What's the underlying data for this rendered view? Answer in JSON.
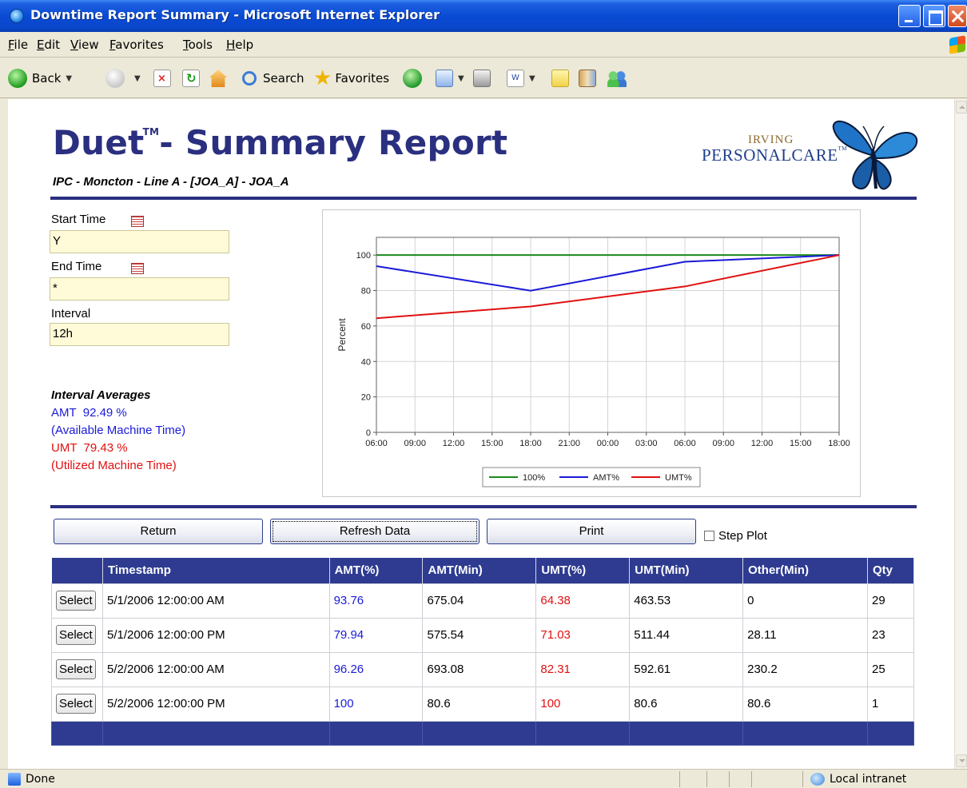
{
  "window": {
    "title": "Downtime Report Summary - Microsoft Internet Explorer"
  },
  "menu": [
    "File",
    "Edit",
    "View",
    "Favorites",
    "Tools",
    "Help"
  ],
  "toolbar": {
    "back": "Back",
    "search": "Search",
    "favorites": "Favorites"
  },
  "header": {
    "title": "Duet",
    "tm": "TM",
    "title_rest": "- Summary Report",
    "subtitle": "IPC - Moncton - Line A - [JOA_A] - JOA_A",
    "logo_top": "IRVING",
    "logo_bottom": "PERSONALCARE",
    "logo_tm": "TM"
  },
  "form": {
    "start_label": "Start Time",
    "start_value": "Y",
    "end_label": "End Time",
    "end_value": "*",
    "interval_label": "Interval",
    "interval_value": "12h"
  },
  "averages": {
    "heading": "Interval Averages",
    "amt": "AMT  92.49 %",
    "amt_desc": "(Available Machine Time)",
    "umt": "UMT  79.43 %",
    "umt_desc": "(Utilized Machine Time)"
  },
  "chart_data": {
    "type": "line",
    "ylabel": "Percent",
    "ylim": [
      0,
      110
    ],
    "yticks": [
      0,
      20,
      40,
      60,
      80,
      100
    ],
    "xticks": [
      "06:00",
      "09:00",
      "12:00",
      "15:00",
      "18:00",
      "21:00",
      "00:00",
      "03:00",
      "06:00",
      "09:00",
      "12:00",
      "15:00",
      "18:00"
    ],
    "grid": true,
    "legend_position": "bottom",
    "series": [
      {
        "name": "100%",
        "color": "#1a8a1a",
        "points": [
          [
            0,
            100
          ],
          [
            12,
            100
          ]
        ]
      },
      {
        "name": "AMT%",
        "color": "#1a1ad8",
        "points": [
          [
            0,
            93.76
          ],
          [
            4,
            79.94
          ],
          [
            8,
            96.26
          ],
          [
            12,
            100
          ]
        ]
      },
      {
        "name": "UMT%",
        "color": "#e01010",
        "points": [
          [
            0,
            64.38
          ],
          [
            4,
            71.03
          ],
          [
            8,
            82.31
          ],
          [
            12,
            100
          ]
        ]
      }
    ]
  },
  "buttons": {
    "return": "Return",
    "refresh": "Refresh Data",
    "print": "Print",
    "step_plot": "Step Plot"
  },
  "table": {
    "headers": [
      "",
      "Timestamp",
      "AMT(%)",
      "AMT(Min)",
      "UMT(%)",
      "UMT(Min)",
      "Other(Min)",
      "Qty"
    ],
    "select_label": "Select",
    "rows": [
      [
        "5/1/2006 12:00:00 AM",
        "93.76",
        "675.04",
        "64.38",
        "463.53",
        "0",
        "29"
      ],
      [
        "5/1/2006 12:00:00 PM",
        "79.94",
        "575.54",
        "71.03",
        "511.44",
        "28.11",
        "23"
      ],
      [
        "5/2/2006 12:00:00 AM",
        "96.26",
        "693.08",
        "82.31",
        "592.61",
        "230.2",
        "25"
      ],
      [
        "5/2/2006 12:00:00 PM",
        "100",
        "80.6",
        "100",
        "80.6",
        "80.6",
        "1"
      ]
    ]
  },
  "status": {
    "left": "Done",
    "zone": "Local intranet"
  }
}
